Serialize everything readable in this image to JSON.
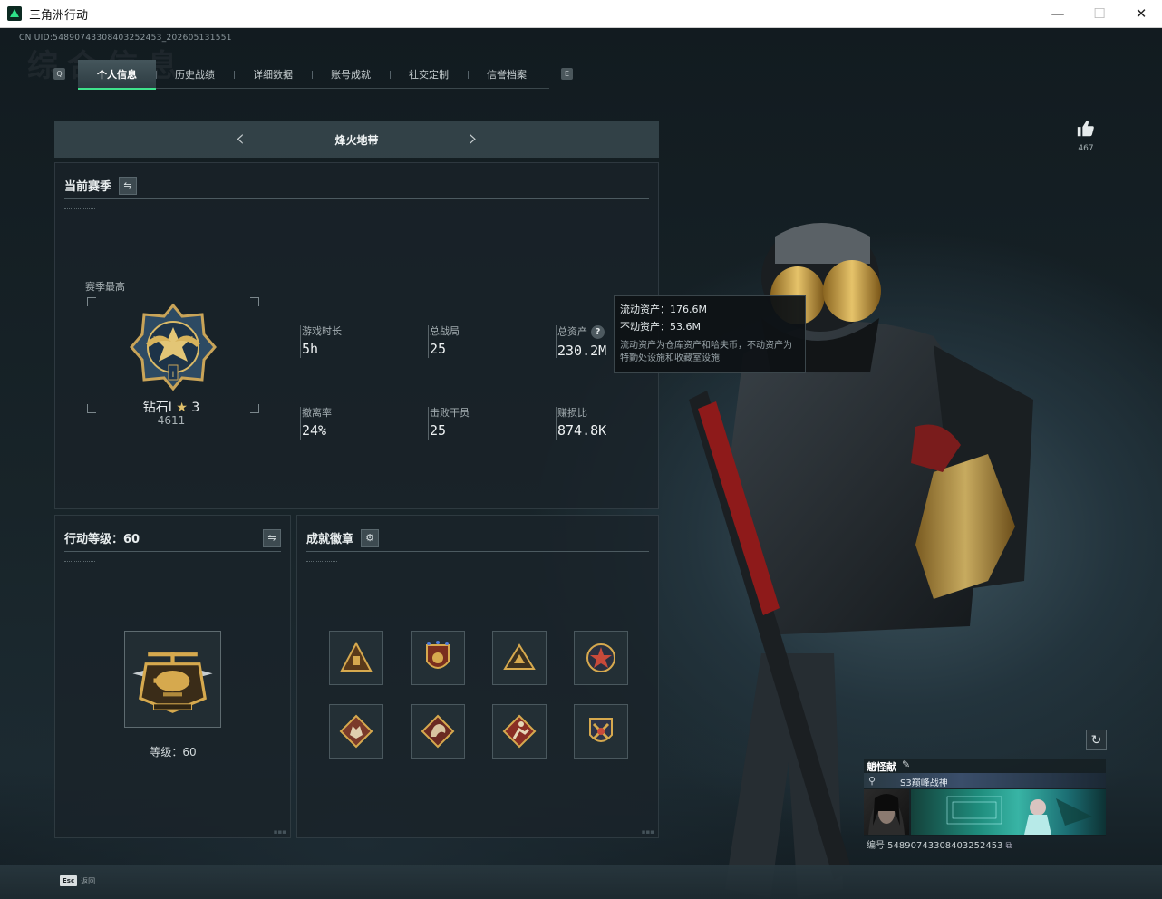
{
  "window": {
    "title": "三角洲行动",
    "min_glyph": "—",
    "max_glyph": "☐",
    "close_glyph": "✕"
  },
  "uid_text": "CN UID:5489074330840325245​3_202605131551",
  "watermark": "综合信息",
  "tab_keys": {
    "left": "Q",
    "right": "E"
  },
  "tabs": [
    {
      "label": "个人信息",
      "active": true
    },
    {
      "label": "历史战绩",
      "active": false
    },
    {
      "label": "详细数据",
      "active": false
    },
    {
      "label": "账号成就",
      "active": false
    },
    {
      "label": "社交定制",
      "active": false
    },
    {
      "label": "信誉档案",
      "active": false
    }
  ],
  "mode": {
    "title": "烽火地带",
    "prev_icon": "chevron-left-icon",
    "next_icon": "chevron-right-icon"
  },
  "season": {
    "title": "当前赛季",
    "swap_icon": "⇋",
    "high_label": "赛季最高",
    "rank_name": "钻石I",
    "rank_star": "★",
    "rank_stars": "3",
    "rank_score": "4611",
    "stats": [
      {
        "label": "游戏时长",
        "value": "5h"
      },
      {
        "label": "总战局",
        "value": "25"
      },
      {
        "label": "总资产",
        "value": "230.2M",
        "help": "?"
      },
      {
        "label": "撤离率",
        "value": "24%"
      },
      {
        "label": "击败干员",
        "value": "25"
      },
      {
        "label": "赚损比",
        "value": "874.8K"
      }
    ]
  },
  "tooltip": {
    "liquid": "流动资产：176.6M",
    "fixed": "不动资产：53.6M",
    "note": "流动资产为仓库资产和哈夫币，不动资产为特勤处设施和收藏室设施"
  },
  "level_panel": {
    "title": "行动等级：60",
    "swap_icon": "⇋",
    "level_text": "等级：60"
  },
  "badges_panel": {
    "title": "成就徽章",
    "settings_icon": "⚙",
    "badges": [
      "pyramid-badge-icon",
      "shield-badge-icon",
      "triangle-badge-icon",
      "star-badge-icon",
      "wolf-badge-icon",
      "dragon-badge-icon",
      "runner-badge-icon",
      "crest-badge-icon"
    ]
  },
  "likes": {
    "count": "467"
  },
  "profile_card": {
    "nickname": "魈怪献",
    "edit_icon": "✎",
    "title_icon": "⚲",
    "title_text": "S3巅峰战神",
    "id_line": "编号 5489074330840325245​3",
    "copy_icon": "⧉"
  },
  "refresh_icon": "↻",
  "bottom": {
    "esc_key": "Esc",
    "esc_label": "返回"
  },
  "colors": {
    "accent": "#3fe38c",
    "gold": "#d4a84a",
    "panel": "#192329"
  }
}
